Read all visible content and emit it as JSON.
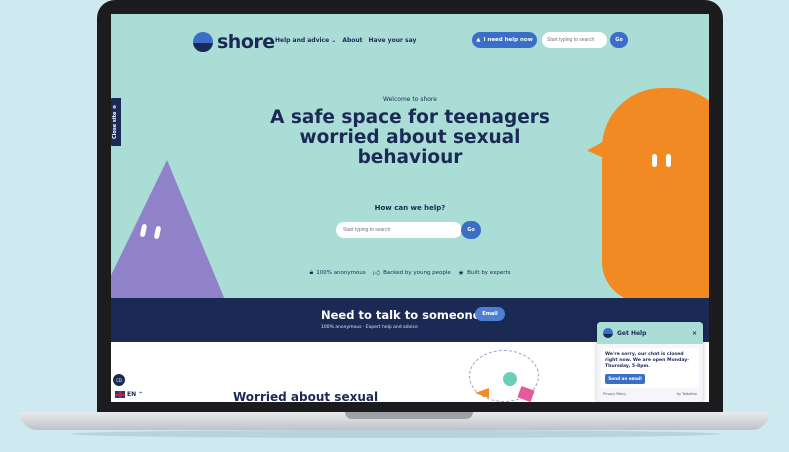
{
  "header": {
    "logo_text": "shore",
    "nav": [
      "Help and advice",
      "About",
      "Have your say"
    ],
    "help_button": "I need help now",
    "search_placeholder": "Start typing to search",
    "go_label": "Go"
  },
  "close_site": {
    "label": "Close site"
  },
  "hero": {
    "welcome": "Welcome to shore",
    "title": "A safe space for teenagers worried about sexual behaviour",
    "help_question": "How can we help?",
    "search_placeholder": "Start typing to search",
    "go_label": "Go",
    "trust": [
      "100% anonymous",
      "Backed by young people",
      "Built by experts"
    ]
  },
  "banner": {
    "title": "Need to talk to someone?",
    "subtitle": "100% anonymous · Expert help and advice",
    "email_button": "Email"
  },
  "lower": {
    "heading": "Worried about sexual"
  },
  "language": {
    "code": "EN",
    "cookie_label": "CD"
  },
  "chat": {
    "title": "Get Help",
    "close": "×",
    "message": "We're sorry, our chat is closed right now. We are open Monday-Thursday, 5-8pm.",
    "email_button": "Send an email",
    "privacy": "Privacy Policy",
    "powered": "by Talkative"
  },
  "colors": {
    "navy": "#1b2a55",
    "accent_blue": "#3b6fc7",
    "mint": "#a9ddd6",
    "orange": "#f28a24",
    "purple": "#8f82c9"
  }
}
